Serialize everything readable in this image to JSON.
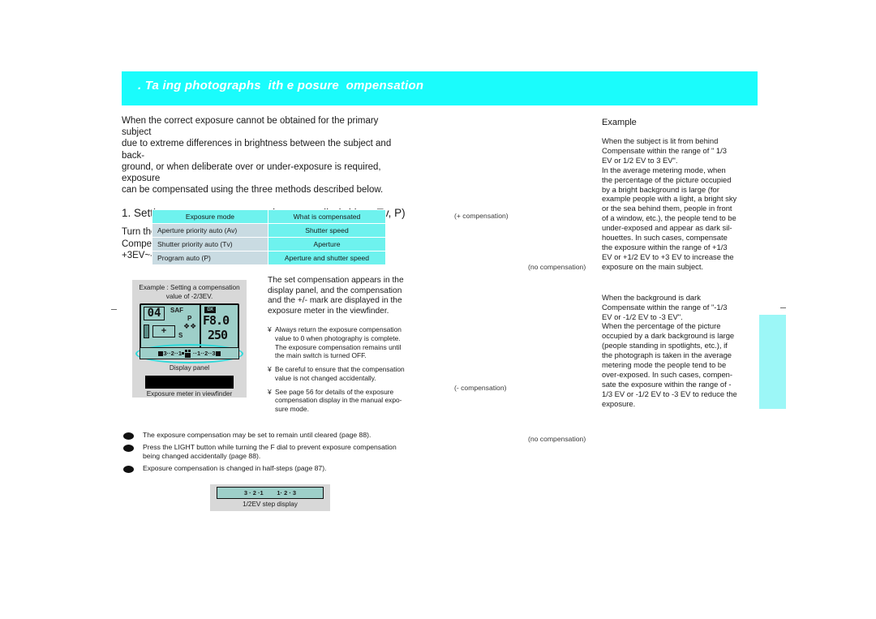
{
  "banner": {
    "title": ". Ta ing photographs  ith e posure  ompensation",
    "bg_color": "#1afcfc",
    "text_color": "#ffffff"
  },
  "left": {
    "intro": "When the correct exposure cannot be obtained for the primary subject\ndue to extreme differences in brightness between the subject and back-\nground, or when deliberate over or under-exposure is required, exposure\ncan be compensated using the three methods described below.",
    "heading": "1. Setting exposure compensation manually (with  v, Tv, P)",
    "sub": "Turn the F dial to set the amount of exposure compensation.\nCompensation may be set in 1/3 EU steps within a range of +3EV~-3EV."
  },
  "table": {
    "headers": [
      "Exposure mode",
      "What is compensated"
    ],
    "rows": [
      [
        "Aperture priority auto (Av)",
        "Shutter speed"
      ],
      [
        "Shutter priority auto (Tv)",
        "Aperture"
      ],
      [
        "Program auto (P)",
        "Aperture and shutter speed"
      ]
    ],
    "header_bg": "#6ef2ee",
    "left_cell_bg": "#c9dbe2",
    "right_cell_bg": "#6ef2ee"
  },
  "illustration": {
    "caption": "Example : Setting a compensation\nvalue of -2/3EV.",
    "lcd": {
      "frame_counter": "04",
      "af_mode": "SAF",
      "mode_p": "P",
      "drive_icon": "drive-icon",
      "mode_s": "S",
      "battery_icon": "battery-icon",
      "plus_mark": "+",
      "dx_badge": "DX",
      "aperture": "F8.0",
      "shutter": "250",
      "meter_left": "3",
      "meter_mid_left": "2",
      "meter_inner_left": "1",
      "meter_inner_right": "1",
      "meter_mid_right": "2",
      "meter_right": "3",
      "meter_dots": "··"
    },
    "display_panel_label": "Display panel",
    "viewfinder_label": "Exposure meter in viewfinder"
  },
  "middle": {
    "paragraph": "The set compensation appears in the\ndisplay panel, and the compensation\nand the  +/-  mark are displayed in the\nexposure meter in the viewfinder.",
    "notes": [
      {
        "mark": "¥",
        "text": "Always return the exposure compensation\nvalue to  0  when photography is complete.\nThe exposure compensation remains until\nthe main switch is turned OFF."
      },
      {
        "mark": "¥",
        "text": "Be careful to ensure that the compensation\nvalue is not changed accidentally."
      },
      {
        "mark": "¥",
        "text": "See page 56 for details of the exposure\ncompensation display in the manual expo-\nsure mode."
      }
    ]
  },
  "bullets": [
    "The exposure compensation may be set to remain until cleared (page 88).",
    "Press the  LIGHT  button while turning the F dial to prevent exposure compensation\nbeing changed accidentally (page 88).",
    "Exposure compensation is changed in half-steps (page 87)."
  ],
  "halfstep": {
    "caption": "1/2EV step display",
    "scale_left": "3 · 2 ·",
    "scale_left_inner": "1",
    "scale_right_inner": "1",
    "scale_right": "· 2 · 3"
  },
  "right": {
    "title": "Example",
    "block1": "When the subject is lit from behind\nCompensate within the range of \"  1/3\nEV or   1/2 EV to   3 EV\".\nIn the average metering mode, when\nthe percentage of the picture occupied\nby a bright background is large (for\nexample people with a light, a bright sky\nor the sea behind them, people in front\nof a window, etc.), the people tend to be\nunder-exposed and appear as dark sil-\nhouettes. In such cases, compensate\nthe exposure within the range of +1/3\nEV or +1/2 EV to +3 EV to increase the\nexposure on the main subject.",
    "block2": "When the background is dark\nCompensate within the range of \"-1/3\nEV or -1/2 EV to -3 EV\".\nWhen the percentage of the picture\noccupied by a dark background is large\n(people standing in spotlights, etc.), if\nthe photograph is taken in the average\nmetering mode the people tend to be\nover-exposed. In such cases, compen-\nsate the exposure within the range of -\n1/3 EV or -1/2 EV to -3 EV to reduce the\nexposure."
  },
  "labels": {
    "plus_compensation": "(+ compensation)",
    "no_compensation_1": "(no compensation)",
    "minus_compensation": "(- compensation)",
    "no_compensation_2": "(no compensation)"
  },
  "decor": {
    "tab_color": "#9cf7f7"
  }
}
